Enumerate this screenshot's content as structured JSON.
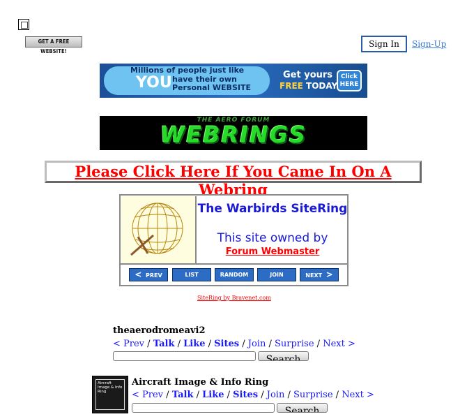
{
  "header": {
    "free_website_label": "GET A FREE WEBSITE!",
    "sign_in_label": "Sign In",
    "sign_up_label": "Sign-Up"
  },
  "ad_banner": {
    "line1": "Millions of people just like",
    "you": "YOU",
    "line2a": "have their own",
    "line2b": "Personal WEBSITE",
    "get_yours": "Get yours",
    "free": "FREE",
    "today": "TODAY!",
    "click_line1": "Click",
    "click_line2": "HERE"
  },
  "webrings_banner": {
    "small": "THE AERO FORUM",
    "big": "WEBRINGS"
  },
  "webring_link": "Please Click Here If You Came In On A Webring",
  "sitering": {
    "title": "The Warbirds SiteRing",
    "owned_by": "This site owned by",
    "owner": "Forum Webmaster",
    "nav": [
      {
        "label": "PREV",
        "arrow": "<"
      },
      {
        "label": "LIST"
      },
      {
        "label": "RANDOM"
      },
      {
        "label": "JOIN"
      },
      {
        "label": "NEXT",
        "arrow": ">"
      }
    ],
    "powered": "SiteRing by Bravenet.com"
  },
  "rings": [
    {
      "name": "theaerodromeavi2",
      "nav": {
        "prev": "< Prev",
        "talk": "Talk",
        "like": "Like",
        "sites": "Sites",
        "join": "Join",
        "surprise": "Surprise",
        "next": "Next >"
      },
      "search_label": "Search"
    },
    {
      "name": "Aircraft Image & Info Ring",
      "image_text": "Aircraft Image & Info Ring",
      "nav": {
        "prev": "< Prev",
        "talk": "Talk",
        "like": "Like",
        "sites": "Sites",
        "join": "Join",
        "surprise": "Surprise",
        "next": "Next >"
      },
      "search_label": "Search"
    }
  ],
  "colors": {
    "link": "#1a1aff",
    "alert_red": "#ff0000",
    "ring_blue": "#1a1ad6",
    "button_blue": "#2d6cc4",
    "banner_green": "#26d92b"
  }
}
